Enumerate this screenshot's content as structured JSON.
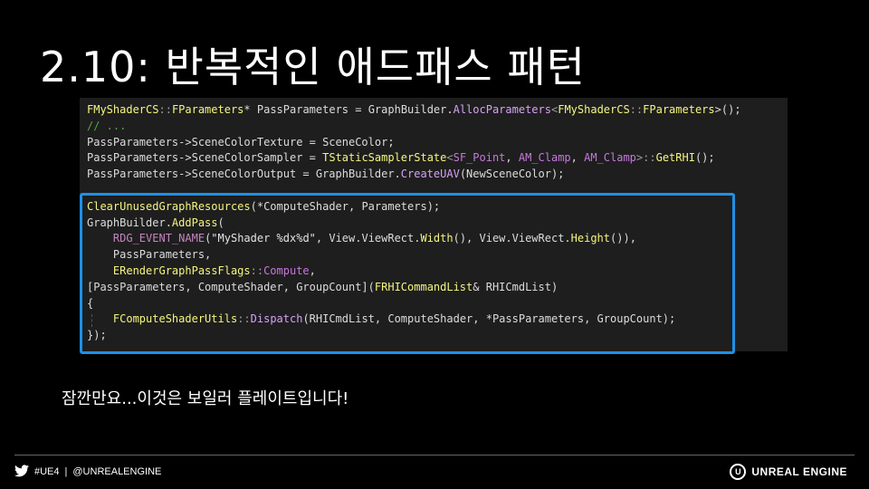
{
  "slide": {
    "title": "2.10: 반복적인 애드패스 패턴",
    "subtitle": "잠깐만요...이것은 보일러 플레이트입니다!"
  },
  "code": {
    "lines": [
      [
        [
          "FMyShaderCS",
          "type"
        ],
        [
          "::",
          "op"
        ],
        [
          "FParameters",
          "type"
        ],
        [
          "* PassParameters = GraphBuilder.",
          "plain"
        ],
        [
          "AllocParameters",
          "func"
        ],
        [
          "<",
          "op"
        ],
        [
          "FMyShaderCS",
          "type"
        ],
        [
          "::",
          "op"
        ],
        [
          "FParameters",
          "type"
        ],
        [
          ">();",
          "plain"
        ]
      ],
      [
        [
          "// ...",
          "cmt"
        ]
      ],
      [
        [
          "PassParameters->SceneColorTexture = SceneColor;",
          "plain"
        ]
      ],
      [
        [
          "PassParameters->SceneColorSampler = ",
          "plain"
        ],
        [
          "TStaticSamplerState",
          "type"
        ],
        [
          "<",
          "op"
        ],
        [
          "SF_Point",
          "purple"
        ],
        [
          ", ",
          "plain"
        ],
        [
          "AM_Clamp",
          "purple"
        ],
        [
          ", ",
          "plain"
        ],
        [
          "AM_Clamp",
          "purple"
        ],
        [
          ">",
          "op"
        ],
        [
          "::",
          "op"
        ],
        [
          "GetRHI",
          "type"
        ],
        [
          "();",
          "plain"
        ]
      ],
      [
        [
          "PassParameters->SceneColorOutput = GraphBuilder.",
          "plain"
        ],
        [
          "CreateUAV",
          "func"
        ],
        [
          "(NewSceneColor);",
          "plain"
        ]
      ],
      [
        [
          "",
          "plain"
        ]
      ],
      [
        [
          "ClearUnusedGraphResources",
          "type"
        ],
        [
          "(*ComputeShader, Parameters);",
          "plain"
        ]
      ],
      [
        [
          "GraphBuilder.",
          "plain"
        ],
        [
          "AddPass",
          "type"
        ],
        [
          "(",
          "plain"
        ]
      ],
      [
        [
          "    ",
          "plain"
        ],
        [
          "RDG_EVENT_NAME",
          "macro"
        ],
        [
          "(",
          "plain"
        ],
        [
          "\"MyShader %dx%d\"",
          "str"
        ],
        [
          ", View.ViewRect.",
          "plain"
        ],
        [
          "Width",
          "type"
        ],
        [
          "(), View.ViewRect.",
          "plain"
        ],
        [
          "Height",
          "type"
        ],
        [
          "()),",
          "plain"
        ]
      ],
      [
        [
          "    PassParameters,",
          "plain"
        ]
      ],
      [
        [
          "    ",
          "plain"
        ],
        [
          "ERenderGraphPassFlags",
          "type"
        ],
        [
          "::",
          "op"
        ],
        [
          "Compute",
          "purple"
        ],
        [
          ",",
          "plain"
        ]
      ],
      [
        [
          "[PassParameters, ComputeShader, GroupCount](",
          "plain"
        ],
        [
          "FRHICommandList",
          "type"
        ],
        [
          "& RHICmdList)",
          "plain"
        ]
      ],
      [
        [
          "{",
          "plain"
        ]
      ],
      [
        [
          "    ",
          "plain"
        ],
        [
          "FComputeShaderUtils",
          "type"
        ],
        [
          "::",
          "op"
        ],
        [
          "Dispatch",
          "func"
        ],
        [
          "(RHICmdList, ComputeShader, *PassParameters, GroupCount);",
          "plain"
        ]
      ],
      [
        [
          "});",
          "plain"
        ]
      ]
    ]
  },
  "footer": {
    "twitter_icon": "twitter-bird-icon",
    "hashtag": "#UE4",
    "separator": "|",
    "handle": "@UNREALENGINE",
    "brand_logo": "unreal-engine-logo",
    "brand_logo_letter": "U",
    "brand_name": "UNREAL ENGINE"
  },
  "colors": {
    "background": "#000000",
    "code_background": "#1e1e1e",
    "highlight_border": "#1e90e6"
  }
}
